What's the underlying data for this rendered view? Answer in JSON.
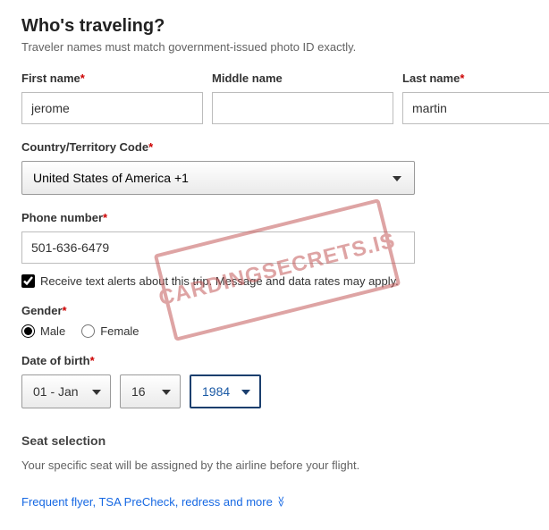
{
  "heading": "Who's traveling?",
  "subtext": "Traveler names must match government-issued photo ID exactly.",
  "first_name": {
    "label": "First name",
    "value": "jerome"
  },
  "middle_name": {
    "label": "Middle name",
    "value": ""
  },
  "last_name": {
    "label": "Last name",
    "value": "martin"
  },
  "country": {
    "label": "Country/Territory Code",
    "value": "United States of America +1"
  },
  "phone": {
    "label": "Phone number",
    "value": "501-636-6479"
  },
  "alerts": {
    "label": "Receive text alerts about this trip. Message and data rates may apply.",
    "checked": true
  },
  "gender": {
    "label": "Gender",
    "options": {
      "male": "Male",
      "female": "Female"
    },
    "selected": "male"
  },
  "dob": {
    "label": "Date of birth",
    "month": "01 - Jan",
    "day": "16",
    "year": "1984"
  },
  "seat": {
    "heading": "Seat selection",
    "text": "Your specific seat will be assigned by the airline before your flight."
  },
  "more_link": "Frequent flyer, TSA PreCheck, redress and more",
  "stamp_text": "CARDINGSECRETS.IS"
}
